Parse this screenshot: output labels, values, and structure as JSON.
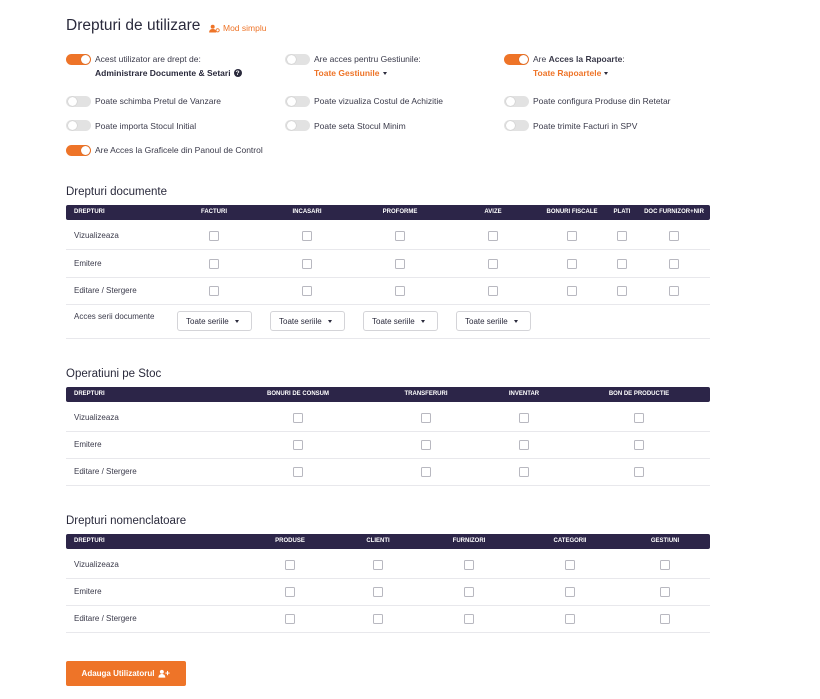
{
  "page": {
    "title": "Drepturi de utilizare",
    "mode_link": "Mod simplu"
  },
  "permissions": [
    {
      "id": "admin_docs",
      "on": true,
      "label": "Acest utilizator are drept de:",
      "sub": "Administrare Documente & Setari"
    },
    {
      "id": "gestiuni",
      "on": false,
      "label": "Are acces pentru Gestiunile:",
      "dropdown": "Toate Gestiunile"
    },
    {
      "id": "rapoarte",
      "on": true,
      "label_prefix": "Are ",
      "label_bold": "Acces la Rapoarte",
      "label_suffix": ":",
      "dropdown": "Toate Rapoartele"
    },
    {
      "id": "pret_vanzare",
      "on": false,
      "label": "Poate schimba Pretul de Vanzare"
    },
    {
      "id": "cost_achizitie",
      "on": false,
      "label": "Poate vizualiza Costul de Achizitie"
    },
    {
      "id": "produse_retetar",
      "on": false,
      "label": "Poate configura Produse din Retetar"
    },
    {
      "id": "stoc_initial",
      "on": false,
      "label": "Poate importa Stocul Initial"
    },
    {
      "id": "stoc_minim",
      "on": false,
      "label": "Poate seta Stocul Minim"
    },
    {
      "id": "facturi_spv",
      "on": false,
      "label": "Poate trimite Facturi in SPV"
    },
    {
      "id": "grafice",
      "on": true,
      "label": "Are Acces la Graficele din Panoul de Control"
    }
  ],
  "documents": {
    "title": "Drepturi documente",
    "columns": [
      "DREPTURI",
      "FACTURI",
      "INCASARI",
      "PROFORME",
      "AVIZE",
      "BONURI FISCALE",
      "PLATI",
      "DOC FURNIZOR+NIR"
    ],
    "rows": [
      "Vizualizeaza",
      "Emitere",
      "Editare / Stergere"
    ],
    "series_label": "Acces serii documente",
    "series_selects": [
      "Toate seriile",
      "Toate seriile",
      "Toate seriile",
      "Toate seriile"
    ]
  },
  "stock": {
    "title": "Operatiuni pe Stoc",
    "columns": [
      "DREPTURI",
      "BONURI DE CONSUM",
      "TRANSFERURI",
      "INVENTAR",
      "BON DE PRODUCTIE"
    ],
    "rows": [
      "Vizualizeaza",
      "Emitere",
      "Editare / Stergere"
    ]
  },
  "nomenclature": {
    "title": "Drepturi nomenclatoare",
    "columns": [
      "DREPTURI",
      "PRODUSE",
      "CLIENTI",
      "FURNIZORI",
      "CATEGORII",
      "GESTIUNI"
    ],
    "rows": [
      "Vizualizeaza",
      "Emitere",
      "Editare / Stergere"
    ]
  },
  "footer": {
    "add_button": "Adauga Utilizatorul"
  },
  "icons": {
    "mode_link": "user-cog-icon",
    "help": "question-circle-icon",
    "add_button": "user-plus-icon",
    "dropdown": "caret-down-icon"
  },
  "colors": {
    "accent": "#ee7428",
    "table_header": "#2c2548",
    "toggle_off": "#e2e2e2"
  }
}
